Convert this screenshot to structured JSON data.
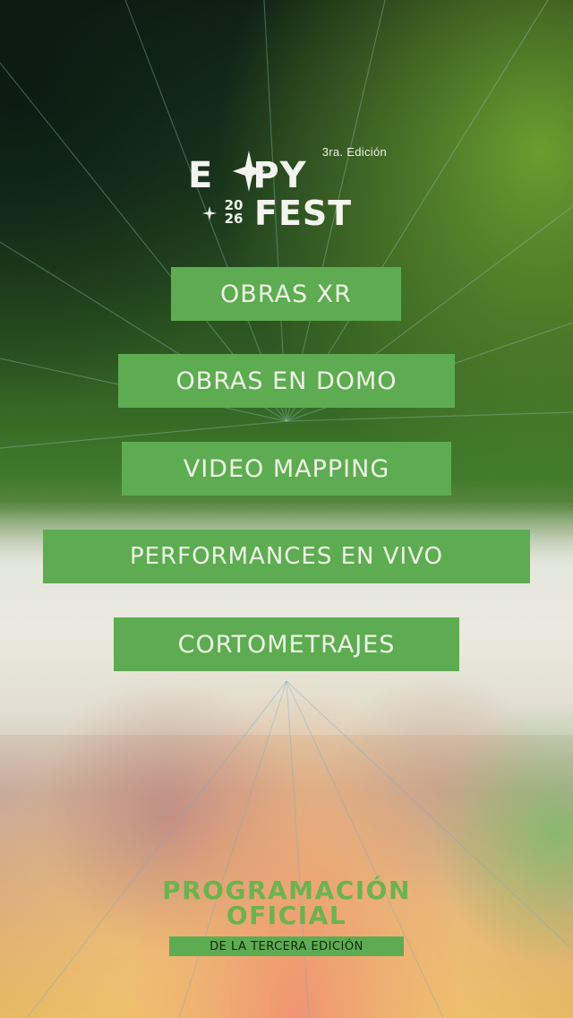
{
  "logo": {
    "edition": "3ra. Edición",
    "top_word_left": "E",
    "top_word_right": "PY",
    "year_top": "20",
    "year_bottom": "26",
    "bottom_word": "FEST"
  },
  "menu": {
    "items": [
      {
        "label": "OBRAS XR"
      },
      {
        "label": "OBRAS EN DOMO"
      },
      {
        "label": "VIDEO MAPPING"
      },
      {
        "label": "PERFORMANCES EN VIVO"
      },
      {
        "label": "CORTOMETRAJES"
      }
    ]
  },
  "footer": {
    "title_line1": "PROGRAMACIÓN",
    "title_line2": "OFICIAL",
    "subtitle": "DE LA TERCERA EDICIÓN"
  },
  "colors": {
    "button_bg": "#5eac51",
    "button_text": "#edf3e6",
    "footer_title": "#6bb34e"
  }
}
